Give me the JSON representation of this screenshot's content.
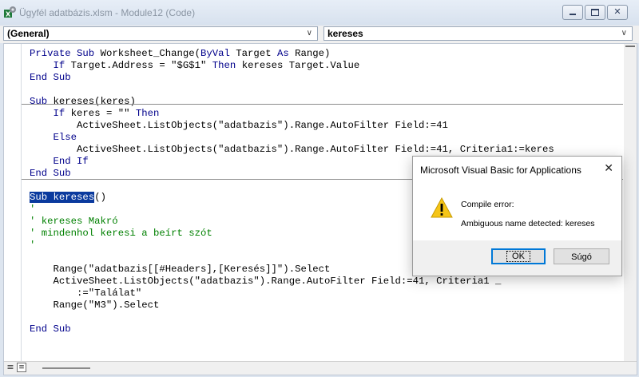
{
  "window": {
    "title": "Ügyfél adatbázis.xlsm - Module12 (Code)",
    "icon": "excel-vba-icon"
  },
  "dropdowns": {
    "object": "(General)",
    "procedure": "kereses"
  },
  "code": {
    "lines": [
      [
        [
          "kw",
          "Private Sub "
        ],
        [
          "n",
          "Worksheet_Change("
        ],
        [
          "kw",
          "ByVal "
        ],
        [
          "n",
          "Target "
        ],
        [
          "kw",
          "As "
        ],
        [
          "n",
          "Range)"
        ]
      ],
      [
        [
          "n",
          "    "
        ],
        [
          "kw",
          "If "
        ],
        [
          "n",
          "Target.Address = \"$G$1\" "
        ],
        [
          "kw",
          "Then "
        ],
        [
          "n",
          "kereses Target.Value"
        ]
      ],
      [
        [
          "kw",
          "End Sub"
        ]
      ],
      [],
      [
        [
          "kw",
          "Sub "
        ],
        [
          "n",
          "kereses(keres)"
        ]
      ],
      [
        [
          "n",
          "    "
        ],
        [
          "kw",
          "If "
        ],
        [
          "n",
          "keres = \"\" "
        ],
        [
          "kw",
          "Then"
        ]
      ],
      [
        [
          "n",
          "        ActiveSheet.ListObjects(\"adatbazis\").Range.AutoFilter Field:=41"
        ]
      ],
      [
        [
          "n",
          "    "
        ],
        [
          "kw",
          "Else"
        ]
      ],
      [
        [
          "n",
          "        ActiveSheet.ListObjects(\"adatbazis\").Range.AutoFilter Field:=41, Criteria1:=keres"
        ]
      ],
      [
        [
          "n",
          "    "
        ],
        [
          "kw",
          "End If"
        ]
      ],
      [
        [
          "kw",
          "End Sub"
        ]
      ],
      [],
      [
        [
          "sel",
          "Sub kereses"
        ],
        [
          "n",
          "()"
        ]
      ],
      [
        [
          "cm",
          "'"
        ]
      ],
      [
        [
          "cm",
          "' kereses Makró"
        ]
      ],
      [
        [
          "cm",
          "' mindenhol keresi a beírt szót"
        ]
      ],
      [
        [
          "cm",
          "'"
        ]
      ],
      [],
      [
        [
          "n",
          "    Range(\"adatbazis[[#Headers],[Keresés]]\").Select"
        ]
      ],
      [
        [
          "n",
          "    ActiveSheet.ListObjects(\"adatbazis\").Range.AutoFilter Field:=41, Criteria1 _"
        ]
      ],
      [
        [
          "n",
          "        :=\"Találat\""
        ]
      ],
      [
        [
          "n",
          "    Range(\"M3\").Select"
        ]
      ],
      [],
      [
        [
          "kw",
          "End Sub"
        ]
      ]
    ]
  },
  "dialog": {
    "title": "Microsoft Visual Basic for Applications",
    "close_glyph": "✕",
    "heading": "Compile error:",
    "message": "Ambiguous name detected: kereses",
    "ok_label": "OK",
    "help_label": "Súgó",
    "icon": "warning-icon"
  },
  "colors": {
    "keyword": "#00008b",
    "comment": "#008000",
    "selection": "#0a3a9e"
  }
}
